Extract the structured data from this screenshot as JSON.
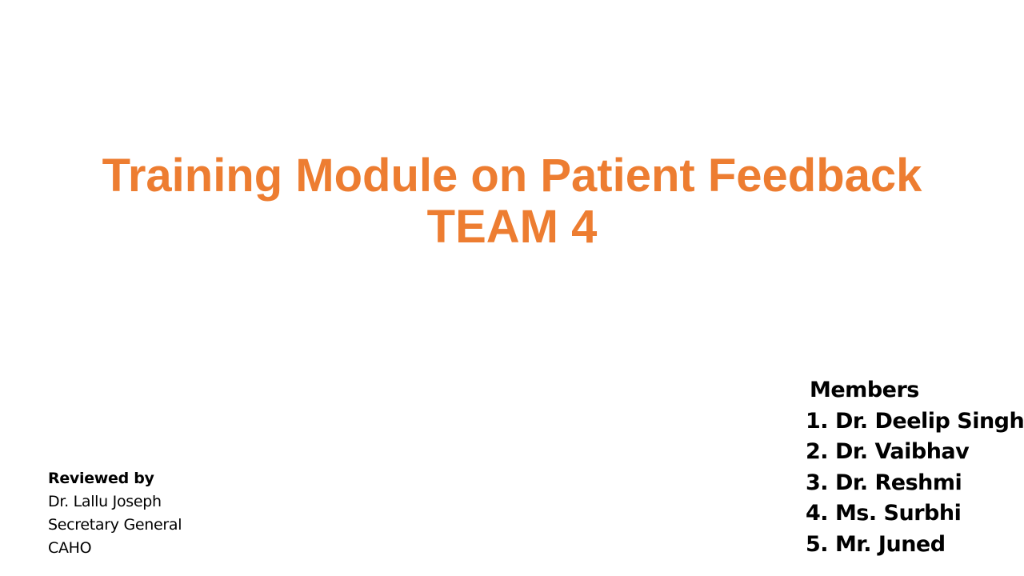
{
  "slide": {
    "title": {
      "line1": "Training Module on Patient Feedback",
      "line2": "TEAM 4"
    },
    "members": {
      "heading": "Members",
      "items": [
        "1. Dr. Deelip Singh",
        "2. Dr. Vaibhav",
        "3. Dr. Reshmi",
        "4. Ms. Surbhi",
        "5. Mr. Juned"
      ]
    },
    "reviewed": {
      "heading": "Reviewed by",
      "name": "Dr. Lallu Joseph",
      "role": "Secretary General",
      "organization": "CAHO"
    }
  },
  "colors": {
    "title": "#ED7D31",
    "text": "#000000",
    "background": "#FFFFFF"
  }
}
